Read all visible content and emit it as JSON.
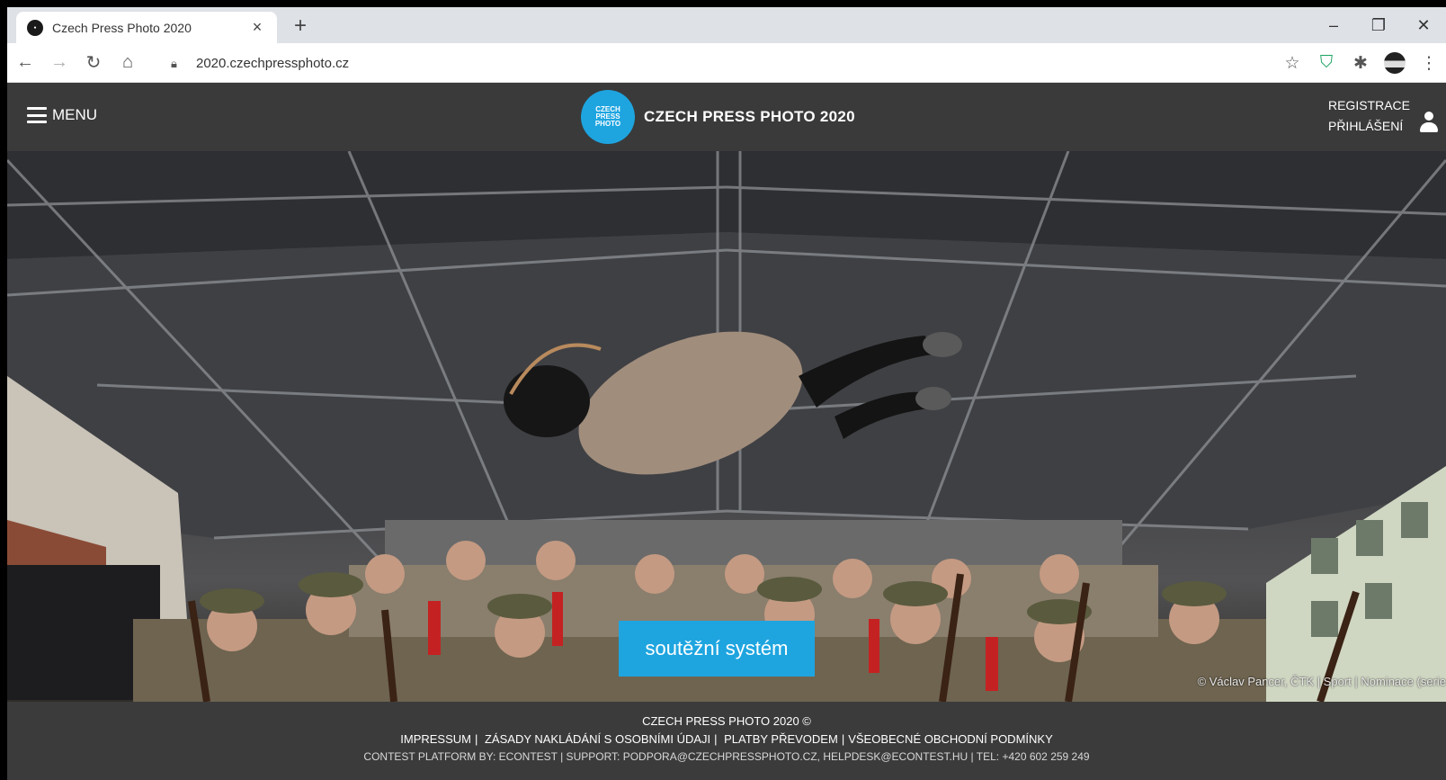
{
  "browser": {
    "tab_title": "Czech Press Photo 2020",
    "tab_close": "×",
    "new_tab": "+",
    "url": "2020.czechpressphoto.cz",
    "window_controls": {
      "minimize": "–",
      "restore": "❐",
      "close": "✕"
    },
    "icons": [
      "back-icon",
      "forward-icon",
      "reload-icon",
      "home-icon",
      "lock-icon",
      "star-icon",
      "shield-extension-icon",
      "puzzle-extension-icon",
      "profile-avatar",
      "kebab-menu-icon"
    ]
  },
  "header": {
    "menu_label": "MENU",
    "logo_lines": [
      "CZECH",
      "PRESS",
      "PHOTO"
    ],
    "site_title": "CZECH PRESS PHOTO 2020",
    "register_label": "REGISTRACE",
    "login_label": "PŘIHLÁŠENÍ"
  },
  "hero": {
    "cta_label": "soutěžní systém",
    "photo_credit": "© Václav Pancer, ČTK | Sport | Nominace (serie"
  },
  "footer": {
    "copyright": "CZECH PRESS PHOTO 2020 ©",
    "links": [
      "IMPRESSUM",
      "ZÁSADY NAKLÁDÁNÍ S OSOBNÍMI ÚDAJI",
      "PLATBY PŘEVODEM",
      "VŠEOBECNÉ OBCHODNÍ PODMÍNKY"
    ],
    "link_separators": [
      "| ",
      "| ",
      "|"
    ],
    "platform": "CONTEST PLATFORM BY: ECONTEST | SUPPORT: PODPORA@CZECHPRESSPHOTO.CZ, HELPDESK@ECONTEST.HU | TEL: +420 602 259 249"
  },
  "colors": {
    "accent": "#1ea5e0",
    "header_bg": "#3a3a3a",
    "footer_bg": "#3b3b3b"
  }
}
